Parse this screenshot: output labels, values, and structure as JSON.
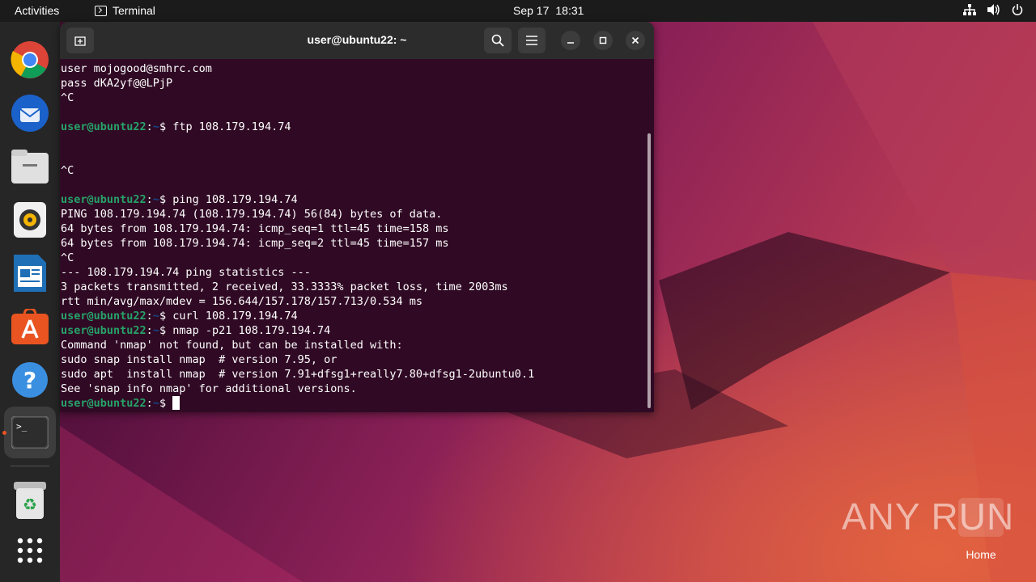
{
  "topbar": {
    "activities": "Activities",
    "app_name": "Terminal",
    "date": "Sep 17",
    "time": "18:31",
    "tray_icons": [
      "network-icon",
      "volume-icon",
      "power-icon"
    ]
  },
  "dock": {
    "items": [
      {
        "name": "chrome",
        "icon": "chrome-icon"
      },
      {
        "name": "thunderbird",
        "icon": "thunderbird-icon"
      },
      {
        "name": "files",
        "icon": "files-icon"
      },
      {
        "name": "rhythmbox",
        "icon": "rhythmbox-icon"
      },
      {
        "name": "libreoffice-writer",
        "icon": "writer-icon"
      },
      {
        "name": "app-center",
        "icon": "app-center-icon"
      },
      {
        "name": "help",
        "icon": "help-icon"
      },
      {
        "name": "terminal",
        "icon": "terminal-icon",
        "active": true
      },
      {
        "name": "trash",
        "icon": "trash-icon"
      },
      {
        "name": "show-apps",
        "icon": "app-grid-icon"
      }
    ]
  },
  "terminal": {
    "title": "user@ubuntu22: ~",
    "prompt": {
      "user": "user@ubuntu22",
      "sep": ":",
      "path": "~",
      "dollar": "$ "
    },
    "lines": [
      {
        "type": "out",
        "text": "user mojogood@smhrc.com"
      },
      {
        "type": "out",
        "text": "pass dKA2yf@@LPjP"
      },
      {
        "type": "out",
        "text": "^C"
      },
      {
        "type": "out",
        "text": ""
      },
      {
        "type": "cmd",
        "text": "ftp 108.179.194.74"
      },
      {
        "type": "out",
        "text": ""
      },
      {
        "type": "out",
        "text": ""
      },
      {
        "type": "out",
        "text": "^C"
      },
      {
        "type": "out",
        "text": ""
      },
      {
        "type": "cmd",
        "text": "ping 108.179.194.74"
      },
      {
        "type": "out",
        "text": "PING 108.179.194.74 (108.179.194.74) 56(84) bytes of data."
      },
      {
        "type": "out",
        "text": "64 bytes from 108.179.194.74: icmp_seq=1 ttl=45 time=158 ms"
      },
      {
        "type": "out",
        "text": "64 bytes from 108.179.194.74: icmp_seq=2 ttl=45 time=157 ms"
      },
      {
        "type": "out",
        "text": "^C"
      },
      {
        "type": "out",
        "text": "--- 108.179.194.74 ping statistics ---"
      },
      {
        "type": "out",
        "text": "3 packets transmitted, 2 received, 33.3333% packet loss, time 2003ms"
      },
      {
        "type": "out",
        "text": "rtt min/avg/max/mdev = 156.644/157.178/157.713/0.534 ms"
      },
      {
        "type": "cmd",
        "text": "curl 108.179.194.74"
      },
      {
        "type": "cmd",
        "text": "nmap -p21 108.179.194.74"
      },
      {
        "type": "out",
        "text": "Command 'nmap' not found, but can be installed with:"
      },
      {
        "type": "out",
        "text": "sudo snap install nmap  # version 7.95, or"
      },
      {
        "type": "out",
        "text": "sudo apt  install nmap  # version 7.91+dfsg1+really7.80+dfsg1-2ubuntu0.1"
      },
      {
        "type": "out",
        "text": "See 'snap info nmap' for additional versions."
      },
      {
        "type": "prompt",
        "text": ""
      }
    ]
  },
  "desktop": {
    "watermark": "ANY RUN",
    "home_label": "Home"
  },
  "colors": {
    "topbar": "#1b1b1b",
    "dock": "#262626",
    "terminal_bg": "#300a24",
    "prompt_user": "#26a269",
    "prompt_path": "#12488b",
    "accent": "#e95420"
  }
}
